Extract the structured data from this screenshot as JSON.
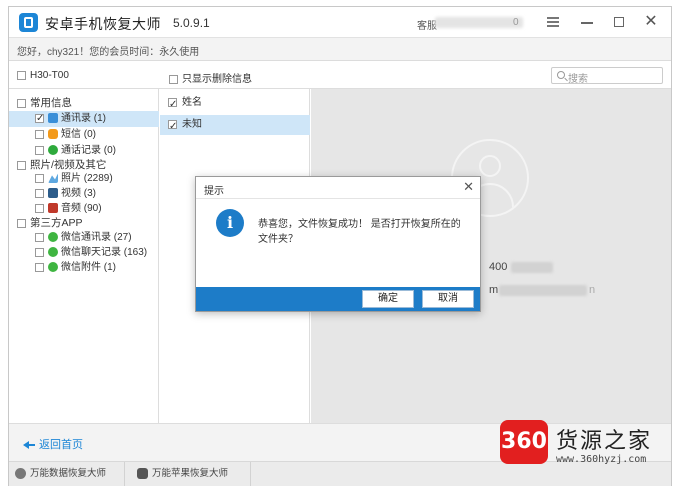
{
  "app": {
    "title": "安卓手机恢复大师",
    "version": "5.0.9.1",
    "service_label": "客服",
    "service_tail": "0"
  },
  "userbar": {
    "text": "您好，chy321！您的会员时间：永久使用"
  },
  "filter": {
    "device": "H30-T00",
    "only_deleted": "只显示删除信息",
    "search_placeholder": "搜索"
  },
  "tree": {
    "groups": [
      {
        "label": "常用信息",
        "items": [
          {
            "label": "通讯录 (1)",
            "icon": "contacts-icon",
            "checked": true,
            "selected": true
          },
          {
            "label": "短信 (0)",
            "icon": "sms-icon"
          },
          {
            "label": "通话记录 (0)",
            "icon": "call-log-icon"
          }
        ]
      },
      {
        "label": "照片/视频及其它",
        "items": [
          {
            "label": "照片 (2289)",
            "icon": "photo-icon"
          },
          {
            "label": "视频 (3)",
            "icon": "video-icon"
          },
          {
            "label": "音频 (90)",
            "icon": "audio-icon"
          }
        ]
      },
      {
        "label": "第三方APP",
        "items": [
          {
            "label": "微信通讯录 (27)",
            "icon": "wechat-icon"
          },
          {
            "label": "微信聊天记录 (163)",
            "icon": "wechat-icon"
          },
          {
            "label": "微信附件 (1)",
            "icon": "wechat-icon"
          }
        ]
      }
    ]
  },
  "names": {
    "header": "姓名",
    "rows": [
      "未知"
    ]
  },
  "detail": {
    "phone_prefix": "400",
    "email_prefix": "m",
    "email_suffix": "n"
  },
  "bottom": {
    "back_label": "返回首页"
  },
  "tabs": [
    "万能数据恢复大师",
    "万能苹果恢复大师"
  ],
  "dialog": {
    "title": "提示",
    "message": "恭喜您，文件恢复成功！ 是否打开恢复所在的文件夹？",
    "ok": "确定",
    "cancel": "取消"
  },
  "watermark": {
    "logo_text": "360",
    "title": "货源之家",
    "url": "www.360hyzj.com"
  },
  "colors": {
    "accent": "#1d86d6",
    "dialog_footer": "#1d7cc8",
    "selection": "#cfe6f8"
  }
}
